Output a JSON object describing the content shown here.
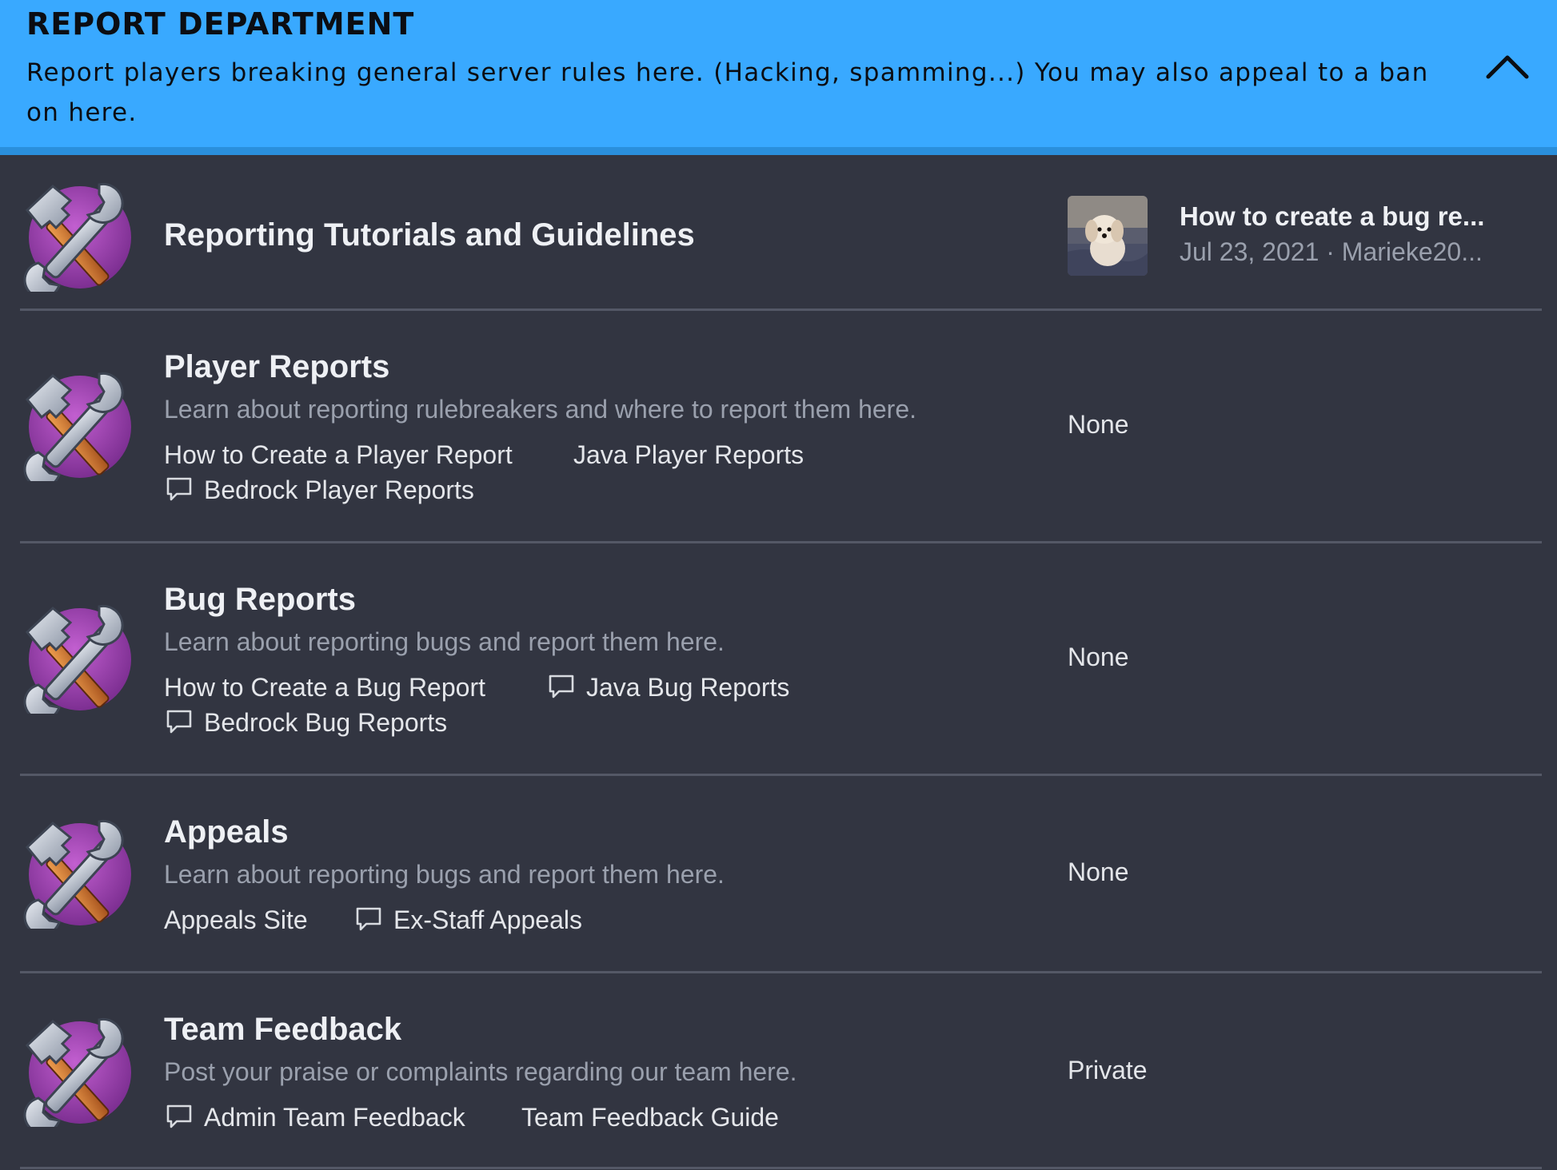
{
  "category": {
    "title": "REPORT DEPARTMENT",
    "description": "Report players breaking general server rules here. (Hacking, spamming...) You may also appeal to a ban on here."
  },
  "forums": [
    {
      "title": "Reporting Tutorials and Guidelines",
      "icon": "tools-icon",
      "latest": {
        "thread_title": "How to create a bug re...",
        "date": "Jul 23, 2021",
        "separator": "·",
        "author": "Marieke20..."
      }
    },
    {
      "title": "Player Reports",
      "description": "Learn about reporting rulebreakers and where to report them here.",
      "icon": "tools-icon",
      "subforums": [
        {
          "label": "How to Create a Player Report",
          "icon": ""
        },
        {
          "label": "Java Player Reports",
          "icon": ""
        },
        {
          "label": "Bedrock Player Reports",
          "icon": "chat-icon"
        }
      ],
      "latest_label": "None"
    },
    {
      "title": "Bug Reports",
      "description": "Learn about reporting bugs and report them here.",
      "icon": "tools-icon",
      "subforums": [
        {
          "label": "How to Create a Bug Report",
          "icon": ""
        },
        {
          "label": "Java Bug Reports",
          "icon": "chat-icon"
        },
        {
          "label": "Bedrock Bug Reports",
          "icon": "chat-icon"
        }
      ],
      "latest_label": "None"
    },
    {
      "title": "Appeals",
      "description": "Learn about reporting bugs and report them here.",
      "icon": "tools-icon",
      "subforums": [
        {
          "label": "Appeals Site",
          "icon": ""
        },
        {
          "label": "Ex-Staff Appeals",
          "icon": "chat-icon"
        }
      ],
      "latest_label": "None"
    },
    {
      "title": "Team Feedback",
      "description": "Post your praise or complaints regarding our team here.",
      "icon": "tools-icon",
      "subforums": [
        {
          "label": "Admin Team Feedback",
          "icon": "chat-icon"
        },
        {
          "label": "Team Feedback Guide",
          "icon": ""
        }
      ],
      "latest_label": "Private"
    }
  ],
  "colors": {
    "header_bg": "#39a9ff",
    "page_bg": "#323541",
    "icon_purple": "#a24bb4"
  }
}
